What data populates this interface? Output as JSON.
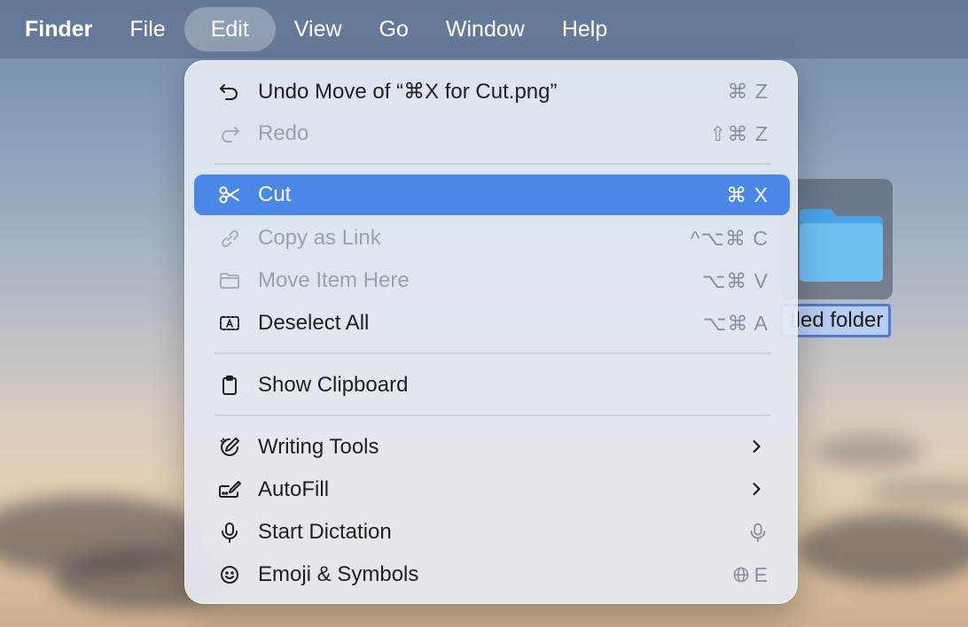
{
  "menubar": {
    "items": [
      "Finder",
      "File",
      "Edit",
      "View",
      "Go",
      "Window",
      "Help"
    ],
    "active": "Edit"
  },
  "desktop": {
    "folder_label": "tled folder"
  },
  "edit_menu": {
    "undo": {
      "label": "Undo Move of “⌘X for Cut.png”",
      "shortcut": "⌘ Z",
      "icon": "undo-icon"
    },
    "redo": {
      "label": "Redo",
      "shortcut": "⇧⌘ Z",
      "icon": "redo-icon",
      "disabled": true
    },
    "cut": {
      "label": "Cut",
      "shortcut": "⌘ X",
      "icon": "scissors-icon",
      "highlighted": true
    },
    "copy_link": {
      "label": "Copy as Link",
      "shortcut": "^⌥⌘ C",
      "icon": "link-icon",
      "disabled": true
    },
    "move_here": {
      "label": "Move Item Here",
      "shortcut": "⌥⌘ V",
      "icon": "folder-icon",
      "disabled": true
    },
    "deselect": {
      "label": "Deselect All",
      "shortcut": "⌥⌘ A",
      "icon": "select-all-icon"
    },
    "clipboard": {
      "label": "Show Clipboard",
      "icon": "clipboard-icon"
    },
    "writing_tools": {
      "label": "Writing Tools",
      "icon": "writing-tools-icon"
    },
    "autofill": {
      "label": "AutoFill",
      "icon": "autofill-icon"
    },
    "dictation": {
      "label": "Start Dictation",
      "shortcut_icon": "microphone-icon",
      "icon": "microphone-icon"
    },
    "emoji": {
      "label": "Emoji & Symbols",
      "shortcut": "E",
      "shortcut_icon": "globe-icon",
      "icon": "smiley-icon"
    }
  },
  "colors": {
    "highlight": "#4b87e8",
    "menubar": "#627492",
    "disabled_text": "#9da1a9"
  }
}
